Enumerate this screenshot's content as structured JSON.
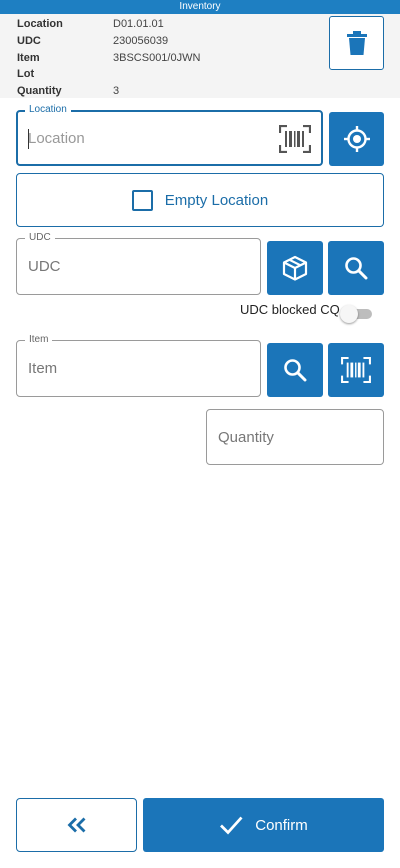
{
  "app": {
    "title": "Inventory"
  },
  "info": {
    "location": {
      "label": "Location",
      "value": "D01.01.01"
    },
    "udc": {
      "label": "UDC",
      "value": "230056039"
    },
    "item": {
      "label": "Item",
      "value": "3BSCS001/0JWN"
    },
    "lot": {
      "label": "Lot",
      "value": ""
    },
    "quantity": {
      "label": "Quantity",
      "value": "3"
    }
  },
  "form": {
    "location": {
      "label": "Location",
      "placeholder": "Location",
      "value": ""
    },
    "empty_location": {
      "label": "Empty Location",
      "checked": false
    },
    "udc": {
      "label": "UDC",
      "placeholder": "UDC",
      "value": ""
    },
    "udc_blocked": {
      "label": "UDC blocked CQ",
      "on": false
    },
    "item": {
      "label": "Item",
      "placeholder": "Item",
      "value": ""
    },
    "quantity": {
      "placeholder": "Quantity",
      "value": ""
    }
  },
  "footer": {
    "back_label": "«",
    "confirm_label": "Confirm"
  },
  "icons": {
    "delete": "trash-icon",
    "location_scan": "barcode-icon",
    "locate": "target-icon",
    "udc_box": "box-icon",
    "udc_search": "search-icon",
    "item_search": "search-icon",
    "item_scan": "barcode-icon",
    "back": "double-chevron-left-icon",
    "confirm": "check-icon"
  },
  "colors": {
    "accent": "#1b75b9",
    "header": "#1e7fc2",
    "panel": "#f4f4f4"
  }
}
